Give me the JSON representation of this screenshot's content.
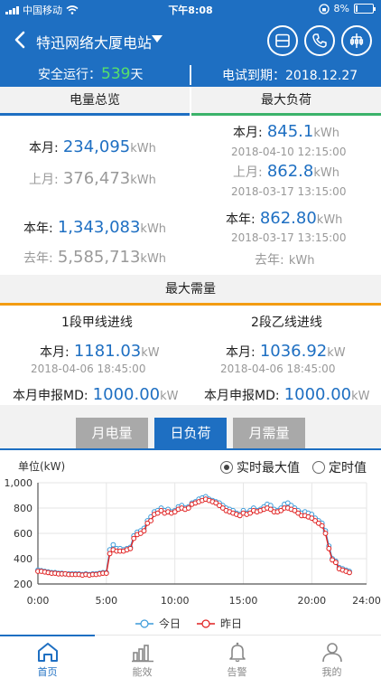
{
  "status": {
    "carrier": "中国移动",
    "time": "下午8:08",
    "battery": "8%"
  },
  "nav": {
    "title": "特迅网络大厦电站"
  },
  "info": {
    "safe_label": "安全运行：",
    "safe_days": "539",
    "safe_unit": "天",
    "expire": "电试到期：2018.12.27"
  },
  "energy": {
    "header": "电量总览",
    "month_label": "本月:",
    "month_value": "234,095",
    "last_month_label": "上月:",
    "last_month_value": "376,473",
    "year_label": "本年:",
    "year_value": "1,343,083",
    "last_year_label": "去年:",
    "last_year_value": "5,585,713",
    "unit": "kWh"
  },
  "maxload": {
    "header": "最大负荷",
    "month_label": "本月:",
    "month_value": "845.1",
    "month_time": "2018-04-10 12:15:00",
    "last_month_label": "上月:",
    "last_month_value": "862.8",
    "last_month_time": "2018-03-17 13:15:00",
    "year_label": "本年:",
    "year_value": "862.80",
    "year_time": "2018-03-17 13:15:00",
    "last_year_label": "去年:",
    "last_year_value": "",
    "unit": "kWh"
  },
  "demand": {
    "header": "最大需量",
    "line1": {
      "title": "1段甲线进线",
      "month_label": "本月:",
      "month_value": "1181.03",
      "month_time": "2018-04-06 18:45:00",
      "md_label": "本月申报MD:",
      "md_value": "1000.00"
    },
    "line2": {
      "title": "2段乙线进线",
      "month_label": "本月:",
      "month_value": "1036.92",
      "month_time": "2018-04-06 18:45:00",
      "md_label": "本月申报MD:",
      "md_value": "1000.00"
    },
    "unit": "kW"
  },
  "tabs": [
    {
      "label": "月电量"
    },
    {
      "label": "日负荷"
    },
    {
      "label": "月需量"
    }
  ],
  "chart_controls": {
    "unit_label": "单位(kW)",
    "radio_realtime": "实时最大值",
    "radio_fixed": "定时值"
  },
  "colors": {
    "primary": "#1e6fc2",
    "today": "#3a9ad9",
    "yesterday": "#e02020",
    "safe_green": "#55e06b"
  },
  "chart_data": {
    "type": "line",
    "title": "",
    "xlabel": "",
    "ylabel": "单位(kW)",
    "x_ticks": [
      "0:00",
      "5:00",
      "10:00",
      "15:00",
      "20:00",
      "24:00"
    ],
    "y_ticks": [
      "200",
      "400",
      "600",
      "800",
      "1,000"
    ],
    "xlim": [
      0,
      24
    ],
    "ylim": [
      200,
      1000
    ],
    "grid": true,
    "legend_position": "bottom",
    "x": [
      0,
      0.25,
      0.5,
      0.75,
      1,
      1.25,
      1.5,
      1.75,
      2,
      2.25,
      2.5,
      2.75,
      3,
      3.25,
      3.5,
      3.75,
      4,
      4.25,
      4.5,
      4.75,
      5,
      5.25,
      5.5,
      5.75,
      6,
      6.25,
      6.5,
      6.75,
      7,
      7.25,
      7.5,
      7.75,
      8,
      8.25,
      8.5,
      8.75,
      9,
      9.25,
      9.5,
      9.75,
      10,
      10.25,
      10.5,
      10.75,
      11,
      11.25,
      11.5,
      11.75,
      12,
      12.25,
      12.5,
      12.75,
      13,
      13.25,
      13.5,
      13.75,
      14,
      14.25,
      14.5,
      14.75,
      15,
      15.25,
      15.5,
      15.75,
      16,
      16.25,
      16.5,
      16.75,
      17,
      17.25,
      17.5,
      17.75,
      18,
      18.25,
      18.5,
      18.75,
      19,
      19.25,
      19.5,
      19.75,
      20,
      20.25,
      20.5,
      20.75,
      21,
      21.25,
      21.5,
      21.75,
      22,
      22.25,
      22.5,
      22.75,
      23,
      23.25,
      23.5,
      23.75
    ],
    "series": [
      {
        "name": "今日",
        "values": [
          310,
          305,
          300,
          295,
          290,
          290,
          285,
          285,
          280,
          280,
          280,
          280,
          280,
          275,
          280,
          275,
          280,
          280,
          285,
          290,
          290,
          470,
          510,
          480,
          480,
          470,
          480,
          490,
          580,
          610,
          620,
          640,
          700,
          730,
          770,
          780,
          800,
          780,
          790,
          770,
          780,
          810,
          820,
          800,
          810,
          840,
          850,
          870,
          880,
          890,
          870,
          860,
          850,
          840,
          820,
          800,
          790,
          780,
          760,
          750,
          780,
          760,
          780,
          800,
          780,
          790,
          810,
          830,
          820,
          790,
          780,
          800,
          830,
          840,
          820,
          800,
          780,
          760,
          770,
          760,
          750,
          720,
          700,
          680,
          620,
          500,
          400,
          380,
          330,
          320,
          310,
          300
        ]
      },
      {
        "name": "昨日",
        "values": [
          300,
          300,
          295,
          290,
          285,
          285,
          280,
          280,
          280,
          275,
          275,
          275,
          275,
          270,
          275,
          270,
          275,
          275,
          280,
          285,
          285,
          440,
          470,
          460,
          460,
          460,
          470,
          480,
          560,
          590,
          600,
          620,
          680,
          700,
          750,
          760,
          780,
          760,
          770,
          760,
          770,
          790,
          800,
          790,
          800,
          830,
          840,
          850,
          860,
          870,
          860,
          850,
          840,
          820,
          800,
          780,
          770,
          760,
          750,
          740,
          760,
          750,
          760,
          780,
          770,
          780,
          790,
          800,
          790,
          770,
          770,
          780,
          800,
          800,
          790,
          780,
          760,
          740,
          740,
          730,
          720,
          700,
          680,
          660,
          600,
          480,
          390,
          370,
          320,
          310,
          300,
          290
        ]
      }
    ]
  },
  "bottom_nav": [
    {
      "label": "首页"
    },
    {
      "label": "能效"
    },
    {
      "label": "告警"
    },
    {
      "label": "我的"
    }
  ]
}
